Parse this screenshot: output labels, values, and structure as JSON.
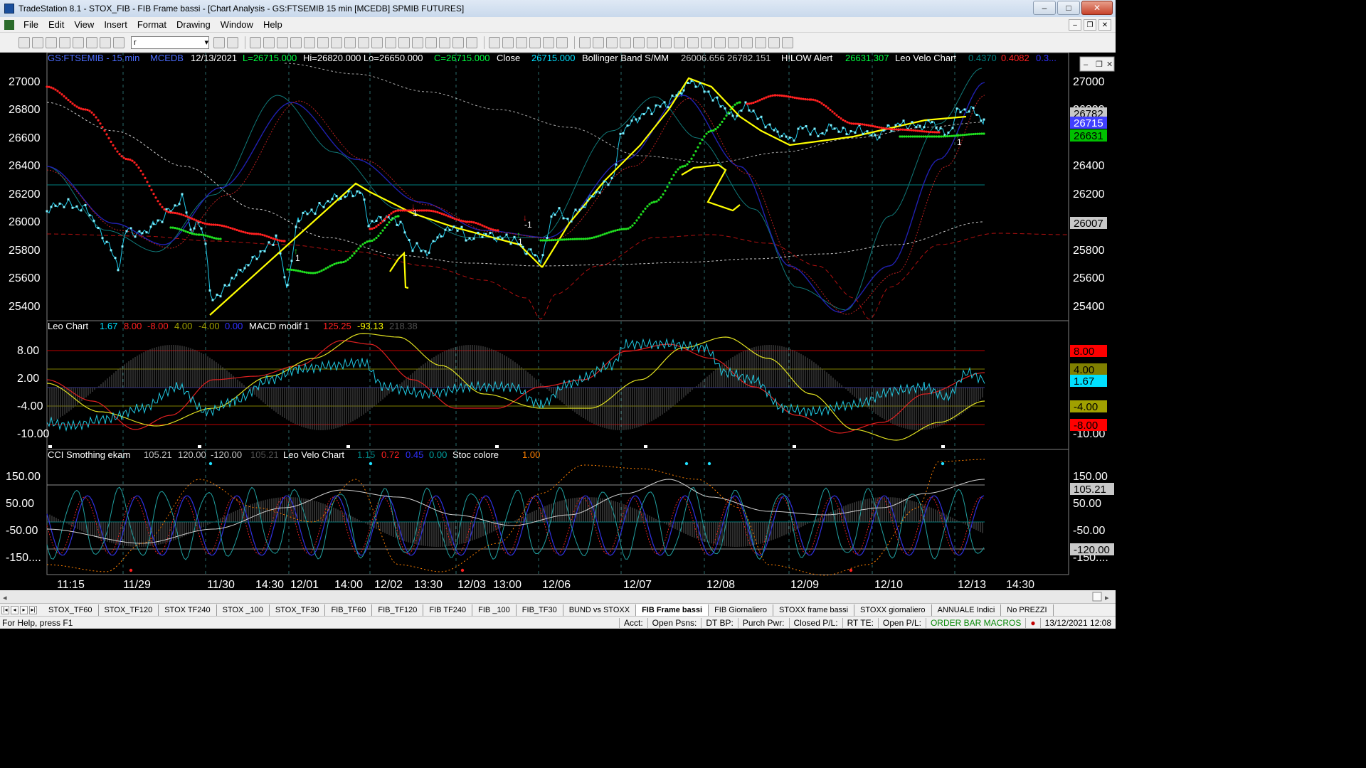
{
  "window": {
    "title": "TradeStation 8.1 - STOX_FIB - FIB Frame bassi - [Chart Analysis - GS:FTSEMIB  15 min  [MCEDB] SPMIB FUTURES]"
  },
  "menu": [
    "File",
    "Edit",
    "View",
    "Insert",
    "Format",
    "Drawing",
    "Window",
    "Help"
  ],
  "toolbar": {
    "symbol_value": "r"
  },
  "price_pane": {
    "header": {
      "symbol": "GS:FTSEMIB - 15 min",
      "source": "MCEDB",
      "date": "12/13/2021",
      "last": "L=26715.000",
      "high_low": "Hi=26820.000  Lo=26650.000",
      "close": "C=26715.000",
      "close_label": "Close",
      "close_value": "26715.000",
      "bollinger_label": "Bollinger Band S/MM",
      "bollinger_values": "26006.656  26782.151",
      "hilow_label": "HILOW Alert",
      "hilow_value": "26631.307",
      "leo_velo_label": "Leo Velo Chart",
      "leo_velo_1": "0.4370",
      "leo_velo_2": "0.4082",
      "leo_velo_3": "0.3..."
    },
    "axis_labels": [
      "27000",
      "26800",
      "26600",
      "26400",
      "26200",
      "26000",
      "25800",
      "25600",
      "25400"
    ],
    "flags": [
      {
        "text": "26782",
        "bg": "#c8c8c8",
        "fg": "#000000"
      },
      {
        "text": "26715",
        "bg": "#4040ff",
        "fg": "#ffffff"
      },
      {
        "text": "26631",
        "bg": "#00c000",
        "fg": "#000000"
      },
      {
        "text": "26007",
        "bg": "#c8c8c8",
        "fg": "#000000"
      }
    ],
    "markers": [
      "1",
      "1",
      "1",
      "-1",
      "1"
    ]
  },
  "leo_pane": {
    "header": {
      "label": "Leo Chart",
      "v1": "1.67",
      "v2": "8.00",
      "v3": "-8.00",
      "v4": "4.00",
      "v5": "-4.00",
      "v6": "0.00",
      "macd_label": "MACD modif 1",
      "macd_1": "125.25",
      "macd_2": "-93.13",
      "macd_3": "218.38"
    },
    "axis_labels": [
      "8.00",
      "2.00",
      "-4.00",
      "-10.00"
    ],
    "flags": [
      {
        "text": "8.00",
        "bg": "#ff0000",
        "fg": "#000000"
      },
      {
        "text": "4.00",
        "bg": "#808000",
        "fg": "#000000"
      },
      {
        "text": "1.67",
        "bg": "#00e0ff",
        "fg": "#000000"
      },
      {
        "text": "-4.00",
        "bg": "#a0a000",
        "fg": "#000000"
      },
      {
        "text": "-8.00",
        "bg": "#ff0000",
        "fg": "#000000"
      }
    ]
  },
  "cci_pane": {
    "header": {
      "label": "CCI Smothing ekam",
      "v1": "105.21",
      "v2": "120.00",
      "v3": "-120.00",
      "v4": "105.21",
      "velo_label": "Leo Velo Chart",
      "velo_1": "1.15",
      "velo_2": "0.72",
      "velo_3": "0.45",
      "velo_4": "0.00",
      "stoc_label": "Stoc colore",
      "stoc_1": "1.00"
    },
    "axis_labels": [
      "150.00",
      "50.00",
      "-50.00",
      "-150...."
    ],
    "flags": [
      {
        "text": "105.21",
        "bg": "#c8c8c8",
        "fg": "#000000"
      },
      {
        "text": "-120.00",
        "bg": "#c8c8c8",
        "fg": "#000000"
      }
    ]
  },
  "time_axis": [
    "11:15",
    "11/29",
    "11/30",
    "14:30",
    "12/01",
    "14:00",
    "12/02",
    "13:30",
    "12/03",
    "13:00",
    "12/06",
    "12/07",
    "12/08",
    "12/09",
    "12/10",
    "12/13",
    "14:30"
  ],
  "tabs": [
    "STOX_TF60",
    "STOX_TF120",
    "STOX TF240",
    "STOX _100",
    "STOX_TF30",
    "FIB_TF60",
    "FIB_TF120",
    "FIB TF240",
    "FIB _100",
    "FIB_TF30",
    "BUND vs STOXX",
    "FIB Frame bassi",
    "FIB Giornaliero",
    "STOXX frame bassi",
    "STOXX giornaliero",
    "ANNUALE Indici",
    "No PREZZI"
  ],
  "active_tab": "FIB Frame bassi",
  "status": {
    "help": "For Help, press F1",
    "acct": "Acct:",
    "open_psns": "Open Psns:",
    "dt_bp": "DT BP:",
    "purch_pwr": "Purch Pwr:",
    "closed_pl": "Closed P/L:",
    "rt_te": "RT TE:",
    "open_pl": "Open P/L:",
    "order_bar": "ORDER BAR  MACROS",
    "datetime": "13/12/2021 12:08"
  }
}
